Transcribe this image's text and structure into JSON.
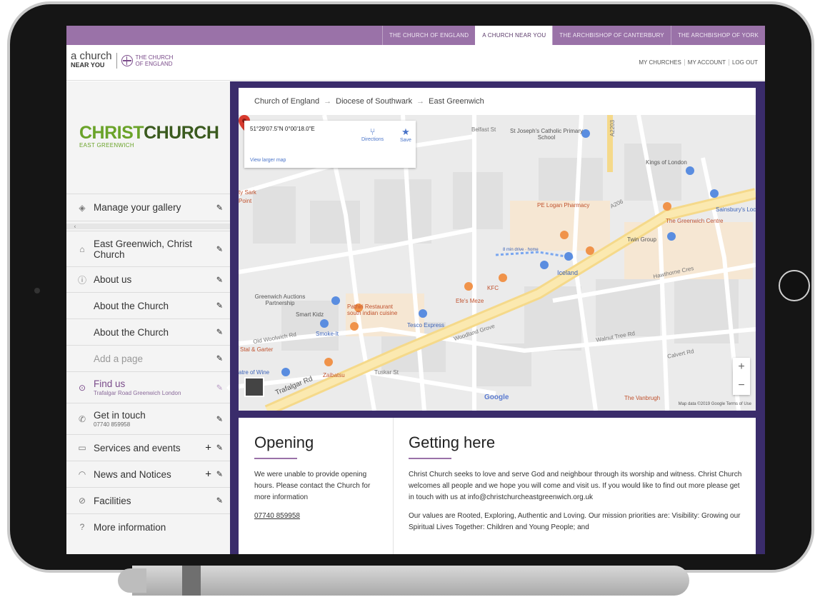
{
  "top_nav": [
    "THE CHURCH OF ENGLAND",
    "A CHURCH NEAR YOU",
    "THE ARCHBISHOP OF CANTERBURY",
    "THE ARCHBISHOP OF YORK"
  ],
  "logo": {
    "line1": "a church",
    "line2": "NEAR YOU",
    "coe1": "THE CHURCH",
    "coe2": "OF ENGLAND"
  },
  "account": [
    "MY CHURCHES",
    "MY ACCOUNT",
    "LOG OUT"
  ],
  "brand": {
    "part1": "CHRIST",
    "part2": "CHURCH",
    "sub": "EAST GREENWICH"
  },
  "menu": [
    {
      "label": "Manage your gallery",
      "sub": ""
    },
    {
      "label": "East Greenwich, Christ Church",
      "sub": ""
    },
    {
      "label": "About us",
      "sub": ""
    },
    {
      "label": "About the Church",
      "sub": ""
    },
    {
      "label": "About the Church",
      "sub": ""
    },
    {
      "label": "Add a page",
      "sub": ""
    },
    {
      "label": "Find us",
      "sub": "Trafalgar Road Greenwich London"
    },
    {
      "label": "Get in touch",
      "sub": "07740 859958"
    },
    {
      "label": "Services and events",
      "sub": ""
    },
    {
      "label": "News and Notices",
      "sub": ""
    },
    {
      "label": "Facilities",
      "sub": ""
    },
    {
      "label": "More information",
      "sub": ""
    }
  ],
  "breadcrumb": [
    "Church of England",
    "Diocese of Southwark",
    "East Greenwich"
  ],
  "map": {
    "coords": "51°29'07.5\"N 0°00'18.0\"E",
    "directions": "Directions",
    "save": "Save",
    "larger": "View larger map",
    "footer": "Map data ©2019 Google   Terms of Use",
    "google": "Google",
    "labels": {
      "belfast": "Belfast St",
      "josephs": "St Joseph's Catholic Primary School",
      "a2203": "A2203",
      "kings": "Kings of London",
      "logan": "PE Logan Pharmacy",
      "sainsbury": "Sainsbury's Loca",
      "centre": "The Greenwich Centre",
      "twin": "Twin Group",
      "iceland": "Iceland",
      "drive": "8 min drive · home",
      "kfc": "KFC",
      "efes": "Efe's Meze",
      "auctions": "Greenwich Auctions Partnership",
      "kidz": "Smart Kidz",
      "pathiri": "Pathiri Restaurant south indian cuisine",
      "tesco": "Tesco Express",
      "smoke": "Smoke-It",
      "stal": "Stal & Garter",
      "wine": "atre of Wine",
      "zaibatsu": "Zaibatsu",
      "vanbrugh": "The Vanbrugh",
      "hawthorne": "Hawthorne Cres",
      "calvert": "Calvert Rd",
      "a206": "A206",
      "trafalgar": "Trafalgar Rd",
      "cutty": "ty Sark",
      "point": "Point",
      "woodland": "Woodland Grove",
      "walnut": "Walnut Tree Rd",
      "tuskar": "Tuskar St",
      "oldwoolwich": "Old Woolwich Rd"
    }
  },
  "opening": {
    "title": "Opening",
    "text": "We were unable to provide opening hours. Please contact the Church for more information",
    "phone": "07740 859958"
  },
  "getting_here": {
    "title": "Getting here",
    "p1": "Christ Church seeks to love and serve God and neighbour through its worship and witness. Christ Church welcomes all people and we hope you will come and visit us. If you would like to find out more please get in touch with us at info@christchurcheastgreenwich.org.uk",
    "p2": "Our values are Rooted, Exploring, Authentic and Loving. Our mission priorities are: Visibility: Growing our Spiritual Lives Together: Children and Young People; and"
  },
  "colors": {
    "purple": "#9a72a8",
    "indigo": "#3a2c6b",
    "green": "#6aa329",
    "pin": "#d83a2e"
  },
  "icons": [
    "diamond-icon",
    "home-icon",
    "info-icon",
    "compass-icon",
    "phone-icon",
    "calendar-icon",
    "broadcast-icon",
    "check-icon",
    "question-icon",
    "pencil-icon",
    "plus-icon",
    "directions-icon",
    "star-icon",
    "map-pin-icon"
  ]
}
